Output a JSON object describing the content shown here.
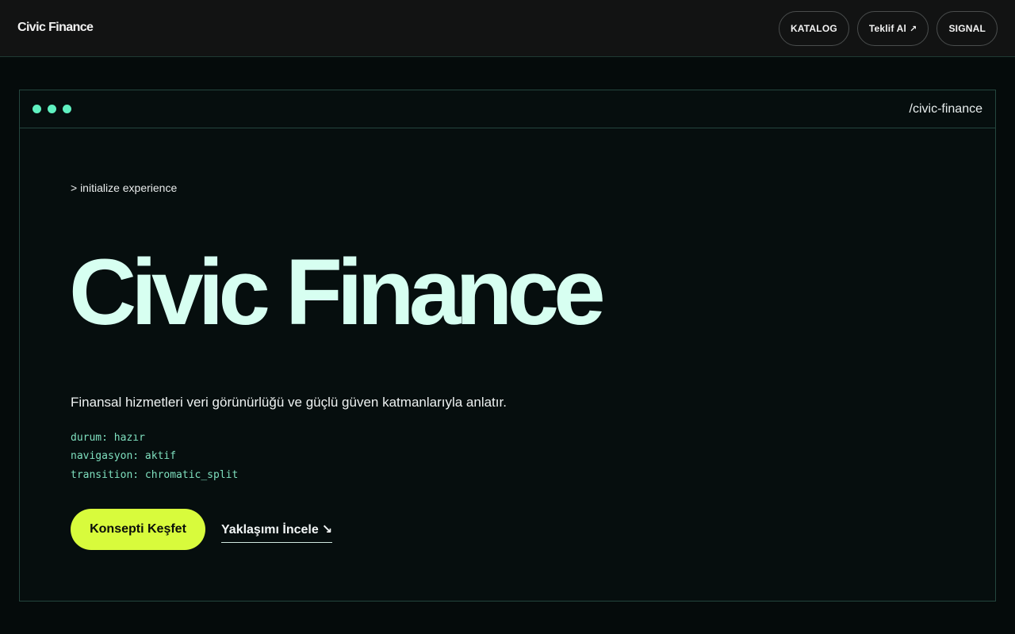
{
  "header": {
    "brand": "Civic Finance",
    "nav": [
      {
        "label": "KATALOG"
      },
      {
        "label": "Teklif Al",
        "arrow": "↗"
      },
      {
        "label": "SIGNAL"
      }
    ]
  },
  "window": {
    "path": "/civic-finance",
    "prompt": "> initialize experience",
    "title": "Civic Finance",
    "description": "Finansal hizmetleri veri görünürlüğü ve güçlü güven katmanlarıyla anlatır.",
    "status_lines": [
      "durum: hazır",
      "navigasyon: aktif",
      "transition: chromatic_split"
    ],
    "cta_primary": "Konsepti Keşfet",
    "cta_secondary": "Yaklaşımı İncele",
    "cta_secondary_icon": "↘"
  },
  "colors": {
    "accent": "#d8fb3c",
    "mint": "#5ff0c0",
    "hero_text": "#d7fff1"
  }
}
